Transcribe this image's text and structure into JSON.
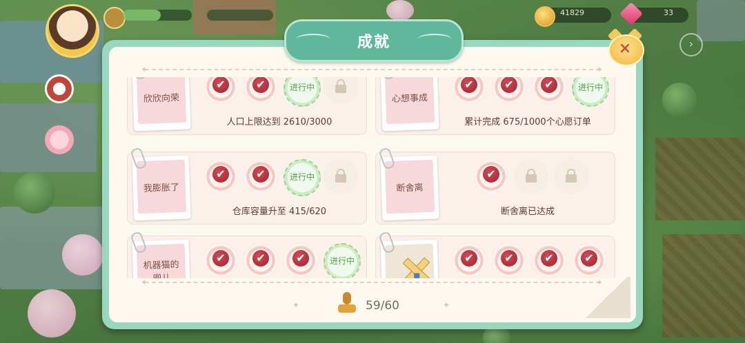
{
  "hud": {
    "coins": "41829",
    "gems": "33"
  },
  "dialog": {
    "title": "成就",
    "close_label": "×",
    "progress": "59/60"
  },
  "achievements": [
    {
      "name": "欣欣向荣",
      "desc": "人口上限达到 2610/3000",
      "stamps": [
        "done",
        "done",
        "progress",
        "locked"
      ],
      "progress_label": "进行中"
    },
    {
      "name": "心想事成",
      "desc": "累计完成 675/1000个心愿订单",
      "stamps": [
        "done",
        "done",
        "done",
        "progress"
      ],
      "progress_label": "进行中"
    },
    {
      "name": "我膨胀了",
      "desc": "仓库容量升至 415/620",
      "stamps": [
        "done",
        "done",
        "progress",
        "locked"
      ],
      "progress_label": "进行中"
    },
    {
      "name": "断舍离",
      "desc": "断舍离已达成",
      "stamps": [
        "done",
        "locked",
        "locked"
      ],
      "progress_label": ""
    },
    {
      "name": "机器猫的兜儿",
      "desc": "",
      "stamps": [
        "done",
        "done",
        "done",
        "progress"
      ],
      "progress_label": "进行中"
    },
    {
      "name": "",
      "desc": "",
      "stamps": [
        "done",
        "done",
        "done",
        "done"
      ],
      "progress_label": "",
      "image": "windmill-icon"
    }
  ]
}
